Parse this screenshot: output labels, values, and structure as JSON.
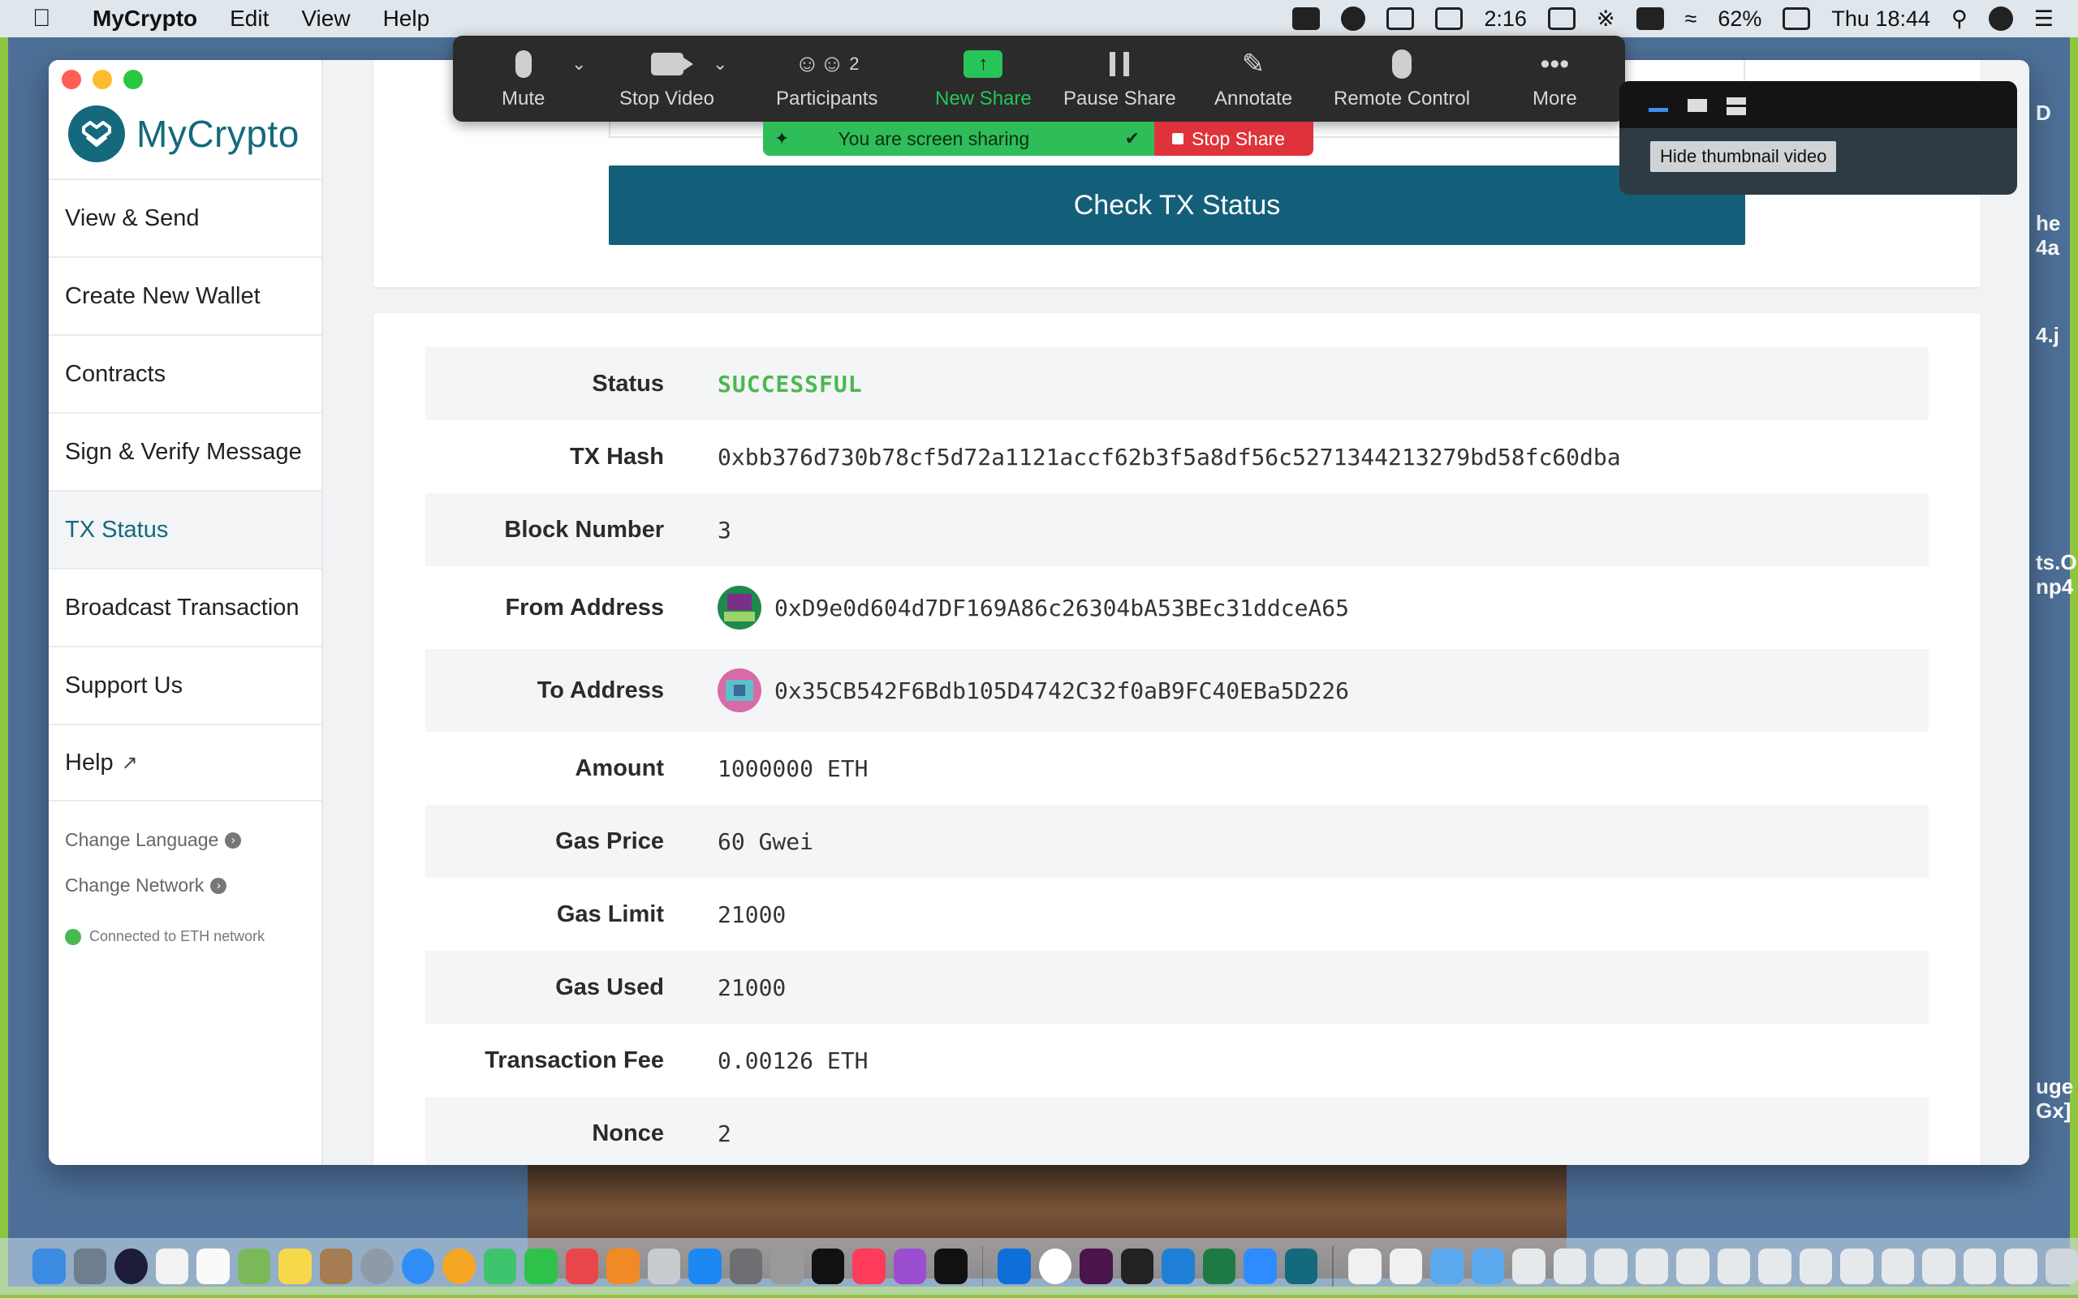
{
  "menubar": {
    "app_name": "MyCrypto",
    "menus": [
      "Edit",
      "View",
      "Help"
    ],
    "battery_time": "2:16",
    "battery_percent": "62%",
    "clock": "Thu 18:44"
  },
  "sidebar": {
    "logo_text": "MyCrypto",
    "nav_items": [
      {
        "label": "View & Send"
      },
      {
        "label": "Create New Wallet"
      },
      {
        "label": "Contracts"
      },
      {
        "label": "Sign & Verify Message"
      },
      {
        "label": "TX Status",
        "active": true
      },
      {
        "label": "Broadcast Transaction"
      },
      {
        "label": "Support Us"
      },
      {
        "label": "Help"
      }
    ],
    "change_language": "Change Language",
    "change_network": "Change Network",
    "network_status": "Connected to ETH network"
  },
  "main": {
    "check_button": "Check TX Status",
    "tx": {
      "status_label": "Status",
      "status_value": "SUCCESSFUL",
      "hash_label": "TX Hash",
      "hash_value": "0xbb376d730b78cf5d72a1121accf62b3f5a8df56c5271344213279bd58fc60dba",
      "block_label": "Block Number",
      "block_value": "3",
      "from_label": "From Address",
      "from_value": "0xD9e0d604d7DF169A86c26304bA53BEc31ddceA65",
      "to_label": "To Address",
      "to_value": "0x35CB542F6Bdb105D4742C32f0aB9FC40EBa5D226",
      "amount_label": "Amount",
      "amount_value": "1000000 ETH",
      "gas_price_label": "Gas Price",
      "gas_price_value": "60 Gwei",
      "gas_limit_label": "Gas Limit",
      "gas_limit_value": "21000",
      "gas_used_label": "Gas Used",
      "gas_used_value": "21000",
      "fee_label": "Transaction Fee",
      "fee_value": "0.00126 ETH",
      "nonce_label": "Nonce",
      "nonce_value": "2"
    }
  },
  "zoom": {
    "mute": "Mute",
    "stop_video": "Stop Video",
    "participants": "Participants",
    "participants_count": "2",
    "new_share": "New Share",
    "pause_share": "Pause Share",
    "annotate": "Annotate",
    "remote_control": "Remote Control",
    "more": "More",
    "sharing_text": "You are screen sharing",
    "stop_share": "Stop Share",
    "tooltip": "Hide thumbnail video"
  },
  "desktop_edge_texts": [
    "D",
    "he",
    "4a",
    "4.j",
    "ts.O",
    "np4",
    "uge",
    "Gx]"
  ],
  "colors": {
    "accent": "#15697d",
    "button": "#135f79",
    "success": "#4bb84f",
    "zoom_green": "#27c45a",
    "zoom_red": "#e0323b"
  }
}
